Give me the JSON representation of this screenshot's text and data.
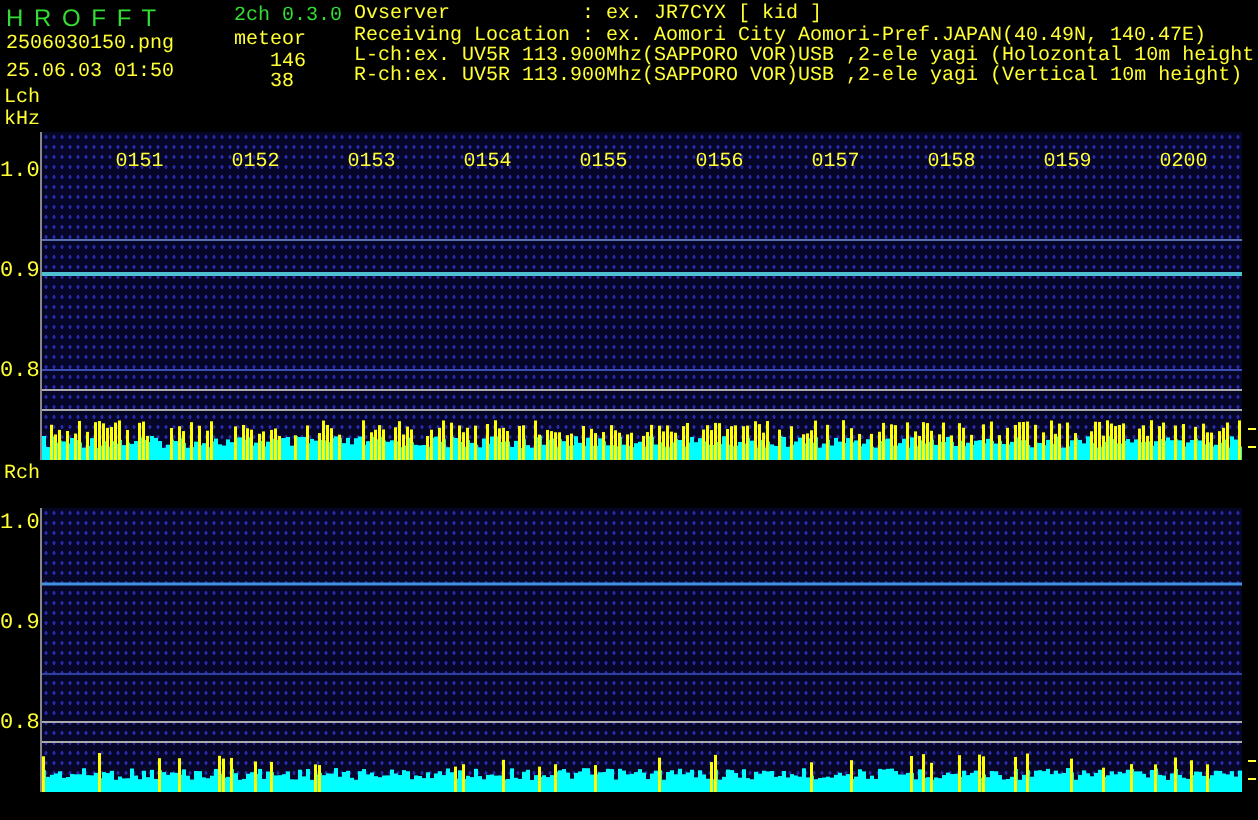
{
  "header": {
    "app_name": "H R O F F T",
    "version": "2ch 0.3.0",
    "filename": "2506030150.png",
    "mode": "meteor",
    "datetime": "25.06.03 01:50",
    "lch_count": "146",
    "rch_count": "38",
    "info": [
      {
        "label": "Ovserver",
        "value": ": ex. JR7CYX [ kid ]"
      },
      {
        "label": "Receiving Location",
        "value": ": ex. Aomori City Aomori-Pref.JAPAN(40.49N, 140.47E)"
      }
    ],
    "channels": [
      "L-ch:ex. UV5R 113.900Mhz(SAPPORO VOR)USB ,2-ele yagi (Holozontal 10m height",
      "R-ch:ex. UV5R 113.900Mhz(SAPPORO VOR)USB ,2-ele yagi (Vertical 10m height)"
    ]
  },
  "panels": [
    {
      "label": "Lch",
      "unit": "kHz",
      "times": [
        "0151",
        "0152",
        "0153",
        "0154",
        "0155",
        "0156",
        "0157",
        "0158",
        "0159",
        "0200"
      ],
      "yticks": [
        "1.0",
        "0.9",
        "0.8"
      ]
    },
    {
      "label": "Rch",
      "yticks": [
        "1.0",
        "0.9",
        "0.8"
      ]
    }
  ]
}
